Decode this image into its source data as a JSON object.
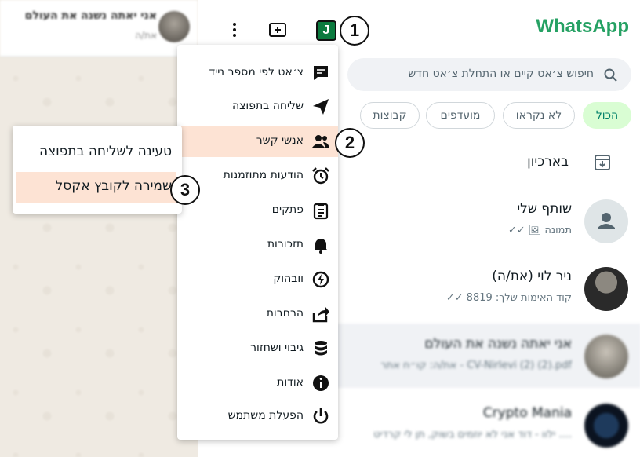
{
  "conversation_header": {
    "name": "אני יאתה נשנה את העולם",
    "subtitle": "את/ה"
  },
  "header": {
    "app_title": "WhatsApp",
    "menu_icon": "kebab-menu-icon",
    "new_chat_icon": "new-chat-icon",
    "extension_icon_letter": "J"
  },
  "steps": [
    "1",
    "2",
    "3"
  ],
  "search": {
    "placeholder": "חיפוש צ׳אט קיים או התחלת צ׳אט חדש"
  },
  "filters": [
    {
      "label": "הכול",
      "active": true
    },
    {
      "label": "לא נקראו",
      "active": false
    },
    {
      "label": "מועדפים",
      "active": false
    },
    {
      "label": "קבוצות",
      "active": false
    }
  ],
  "archive": {
    "label": "בארכיון"
  },
  "chats": [
    {
      "title": "שותף שלי",
      "subtitle": "✓✓ 🖼 תמונה"
    },
    {
      "title": "ניר לוי (את/ה)",
      "subtitle": "✓✓ קוד האימות שלך: 8819"
    },
    {
      "title": "אני יאתה נשנה את העולם",
      "subtitle": "את/ה: קו״ח אתר - CV-Nirlevi (2) (2).pdf"
    },
    {
      "title": "Crypto Mania",
      "subtitle": "ילוו - דוד אני לא יוזמים בשוק, תן לי קרדיט ...."
    }
  ],
  "menu": {
    "items": [
      {
        "label": "צ׳אט לפי מספר נייד",
        "icon": "message-icon"
      },
      {
        "label": "שליחה בתפוצה",
        "icon": "send-icon"
      },
      {
        "label": "אנשי קשר",
        "icon": "contacts-icon"
      },
      {
        "label": "הודעות מתוזמנות",
        "icon": "alarm-clock-icon"
      },
      {
        "label": "פתקים",
        "icon": "clipboard-icon"
      },
      {
        "label": "תזכורות",
        "icon": "bell-icon"
      },
      {
        "label": "וובהוק",
        "icon": "webhook-icon"
      },
      {
        "label": "הרחבות",
        "icon": "share-icon"
      },
      {
        "label": "גיבוי ושחזור",
        "icon": "database-icon"
      },
      {
        "label": "אודות",
        "icon": "info-icon"
      },
      {
        "label": "הפעלת משתמש",
        "icon": "power-icon"
      }
    ],
    "highlighted_index": 2
  },
  "submenu": {
    "items": [
      {
        "label": "טעינה לשליחה בתפוצה"
      },
      {
        "label": "שמירה לקובץ אקסל"
      }
    ],
    "highlighted_index": 1
  },
  "colors": {
    "brand": "#25a163",
    "highlight": "#fde3d4",
    "active_chip": "#d9fdd3"
  }
}
